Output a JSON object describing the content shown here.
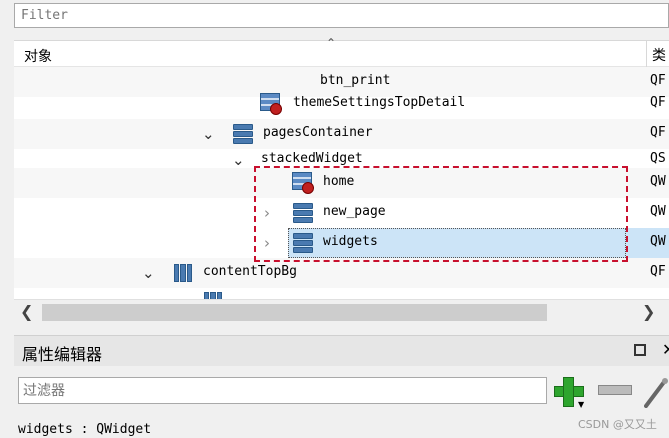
{
  "object_inspector": {
    "filter_placeholder": "Filter",
    "columns": {
      "object": "对象",
      "class": "类"
    },
    "rows": [
      {
        "label": "btn_print",
        "class": "QF"
      },
      {
        "label": "themeSettingsTopDetail",
        "class": "QF"
      },
      {
        "label": "pagesContainer",
        "class": "QF"
      },
      {
        "label": "stackedWidget",
        "class": "QS"
      },
      {
        "label": "home",
        "class": "QW"
      },
      {
        "label": "new_page",
        "class": "QW"
      },
      {
        "label": "widgets",
        "class": "QW"
      },
      {
        "label": "contentTopBg",
        "class": "QF"
      }
    ]
  },
  "property_editor": {
    "title": "属性编辑器",
    "filter_placeholder": "过滤器",
    "object_line": "widgets : QWidget"
  },
  "watermark": "CSDN @又又土",
  "icons": {
    "expanded": "chevron-down-icon",
    "collapsed": "chevron-right-icon",
    "stack": "stacked-layout-icon",
    "promoted": "promoted-widget-icon",
    "columns": "horizontal-layout-icon"
  },
  "colors": {
    "selection": "#cce4f7",
    "annotation": "#c8102e"
  }
}
